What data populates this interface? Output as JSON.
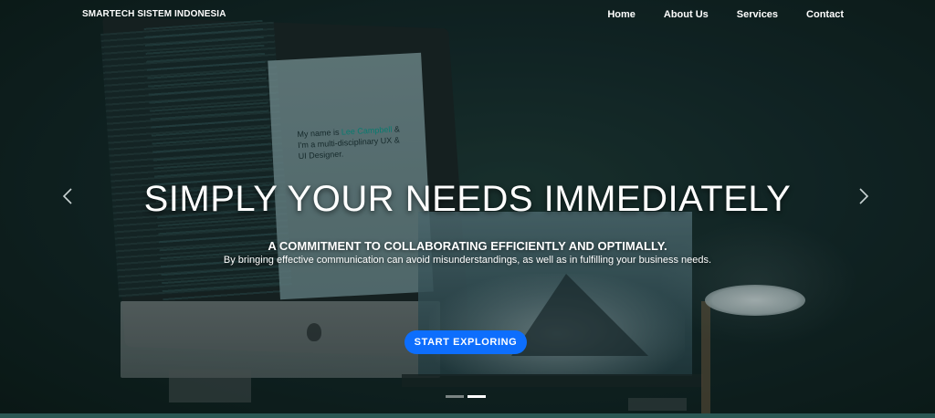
{
  "navbar": {
    "brand": "SMARTECH SISTEM INDONESIA",
    "links": [
      {
        "label": "Home"
      },
      {
        "label": "About Us"
      },
      {
        "label": "Services"
      },
      {
        "label": "Contact"
      }
    ]
  },
  "hero": {
    "headline": "SIMPLY YOUR NEEDS IMMEDIATELY",
    "subheadline": "A COMMITMENT TO COLLABORATING EFFICIENTLY AND OPTIMALLY.",
    "description": "By bringing effective communication can avoid misunderstandings, as well as in fulfilling your business needs.",
    "cta_label": "START EXPLORING",
    "screen_text": {
      "prefix": "My name is ",
      "name": "Lee Campbell",
      "suffix": " & I'm a multi-disciplinary UX & UI Designer."
    }
  },
  "carousel": {
    "prev_icon": "chevron-left-icon",
    "next_icon": "chevron-right-icon",
    "slide_count": 2,
    "active_slide": 2
  },
  "colors": {
    "cta_background": "#0d6efd",
    "background": "#14282a",
    "text": "#ffffff"
  }
}
